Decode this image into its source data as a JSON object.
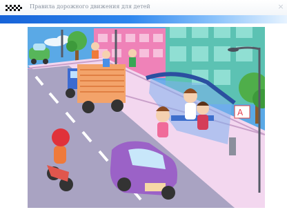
{
  "window": {
    "title": "Правила дорожного движения для детей",
    "close_glyph": "×"
  },
  "colors": {
    "accent_start": "#1763d8",
    "accent_end": "#e7f3ff",
    "sky": "#5aa9e6",
    "road": "#a9a3c2"
  },
  "scene": {
    "bus_stop_sign": "A"
  },
  "icons": {
    "logo": "checkered-flag-icon",
    "close": "close-icon"
  }
}
